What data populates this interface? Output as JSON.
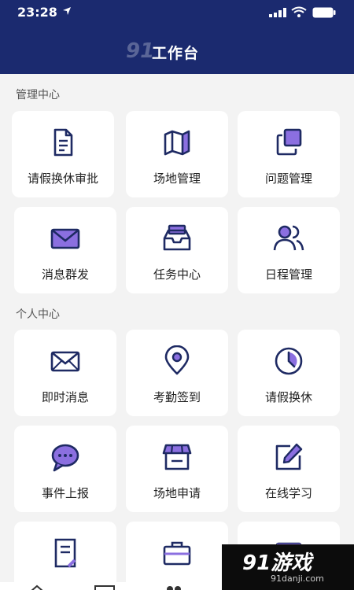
{
  "status": {
    "time": "23:28"
  },
  "header": {
    "title": "工作台",
    "watermark": "91"
  },
  "sections": [
    {
      "title": "管理中心"
    },
    {
      "title": "个人中心"
    }
  ],
  "management": [
    {
      "label": "请假换休审批",
      "icon": "document-icon"
    },
    {
      "label": "场地管理",
      "icon": "map-icon"
    },
    {
      "label": "问题管理",
      "icon": "layers-icon"
    },
    {
      "label": "消息群发",
      "icon": "mail-icon"
    },
    {
      "label": "任务中心",
      "icon": "inbox-icon"
    },
    {
      "label": "日程管理",
      "icon": "users-icon"
    }
  ],
  "personal": [
    {
      "label": "即时消息",
      "icon": "mail-icon"
    },
    {
      "label": "考勤签到",
      "icon": "location-pin-icon"
    },
    {
      "label": "请假换休",
      "icon": "clock-icon"
    },
    {
      "label": "事件上报",
      "icon": "chat-bubble-icon"
    },
    {
      "label": "场地申请",
      "icon": "store-icon"
    },
    {
      "label": "在线学习",
      "icon": "edit-icon"
    }
  ],
  "watermark_br": {
    "main": "91游戏",
    "sub": "91danji.com"
  },
  "colors": {
    "header": "#1b2a6f",
    "icon_navy": "#1e2a63",
    "icon_purple": "#8b6fe0"
  }
}
